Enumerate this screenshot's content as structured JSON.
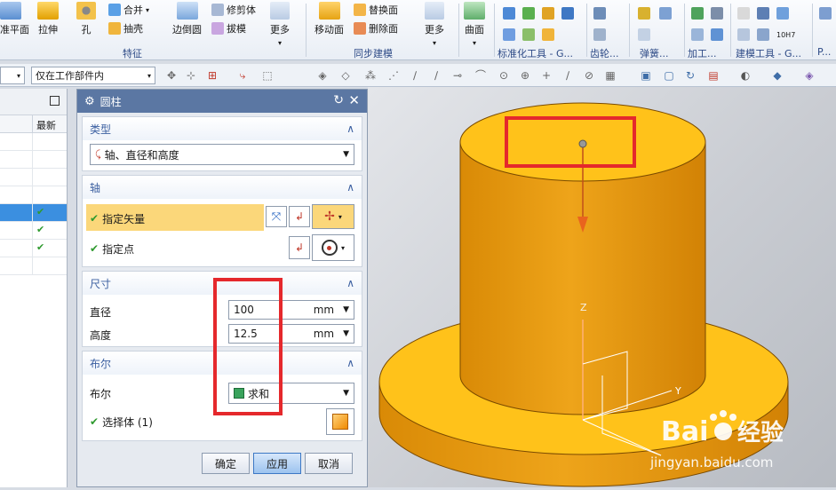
{
  "ribbon": {
    "buttons": {
      "datum_plane": "准平面",
      "extrude": "拉伸",
      "hole": "孔",
      "unite": "合并",
      "shell": "抽壳",
      "edge_blend": "边倒圆",
      "trim_body": "修剪体",
      "draft": "拔模",
      "more1": "更多",
      "move_face": "移动面",
      "replace_face": "替换面",
      "delete_face": "删除面",
      "more2": "更多",
      "surface": "曲面"
    },
    "groups": {
      "feature": "特征",
      "sync_modeling": "同步建模",
      "std_tools": "标准化工具 - G...",
      "gear": "齿轮...",
      "spring": "弹簧...",
      "machining": "加工...",
      "modeling_tools": "建模工具 - G...",
      "more": "P..."
    },
    "mini_label": "10H7"
  },
  "toolbar": {
    "filter_left": "",
    "filter_scope": "仅在工作部件内"
  },
  "navigator": {
    "col_latest": "最新",
    "rows": [
      {
        "selected": false,
        "latest": false
      },
      {
        "selected": false,
        "latest": false
      },
      {
        "selected": false,
        "latest": false
      },
      {
        "selected": false,
        "latest": false
      },
      {
        "selected": true,
        "latest": true
      },
      {
        "selected": false,
        "latest": true
      },
      {
        "selected": false,
        "latest": true
      },
      {
        "selected": false,
        "latest": false
      }
    ]
  },
  "dialog": {
    "title": "圆柱",
    "type_section": {
      "header": "类型",
      "value": "轴、直径和高度"
    },
    "axis_section": {
      "header": "轴",
      "vector_label": "指定矢量",
      "point_label": "指定点"
    },
    "dims_section": {
      "header": "尺寸",
      "diameter_label": "直径",
      "diameter_value": "100",
      "diameter_unit": "mm",
      "height_label": "高度",
      "height_value": "12.5",
      "height_unit": "mm"
    },
    "boolean_section": {
      "header": "布尔",
      "label": "布尔",
      "value": "求和",
      "select_body": "选择体 (1)"
    },
    "buttons": {
      "ok": "确定",
      "apply": "应用",
      "cancel": "取消"
    }
  },
  "viewport": {
    "axis_z": "Z",
    "axis_y": "Y",
    "watermark_brand": "Bai",
    "watermark_brand2": "经验",
    "watermark_url": "jingyan.baidu.com"
  },
  "colors": {
    "part_top": "#ffc21a",
    "part_side": "#e79a0c",
    "highlight": "#e5282c",
    "dialog_title": "#5b77a3",
    "active_row": "#fbd77a"
  }
}
